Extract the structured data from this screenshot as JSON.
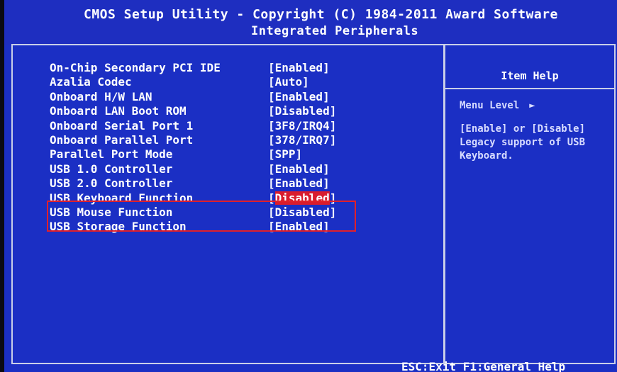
{
  "header": {
    "title": "CMOS Setup Utility - Copyright (C) 1984-2011 Award Software",
    "subtitle": "Integrated Peripherals"
  },
  "settings": [
    {
      "label": "On-Chip Secondary PCI IDE",
      "value": "[Enabled]"
    },
    {
      "label": "Azalia Codec",
      "value": "[Auto]"
    },
    {
      "label": "Onboard H/W LAN",
      "value": "[Enabled]"
    },
    {
      "label": "Onboard LAN Boot ROM",
      "value": "[Disabled]"
    },
    {
      "label": "Onboard Serial Port 1",
      "value": "[3F8/IRQ4]"
    },
    {
      "label": "Onboard Parallel Port",
      "value": "[378/IRQ7]"
    },
    {
      "label": "Parallel Port Mode",
      "value": "[SPP]"
    },
    {
      "label": "USB 1.0 Controller",
      "value": "[Enabled]"
    },
    {
      "label": "USB 2.0 Controller",
      "value": "[Enabled]"
    },
    {
      "label": "USB Keyboard Function",
      "value_open": "[",
      "value_selected": "Disabled",
      "value_close": "]"
    },
    {
      "label": "USB Mouse Function",
      "value": "[Disabled]"
    },
    {
      "label": "USB Storage Function",
      "value": "[Enabled]"
    }
  ],
  "help": {
    "title": "Item Help",
    "menu_level": "Menu Level",
    "menu_level_icon": "arrow-right-icon",
    "description": "[Enable] or [Disable] Legacy support of USB Keyboard."
  },
  "footer": {
    "hint": "ESC:Exit  F1:General Help"
  },
  "colors": {
    "background": "#1b2fc4",
    "highlight": "#d91c2e",
    "text": "#ffffff"
  }
}
